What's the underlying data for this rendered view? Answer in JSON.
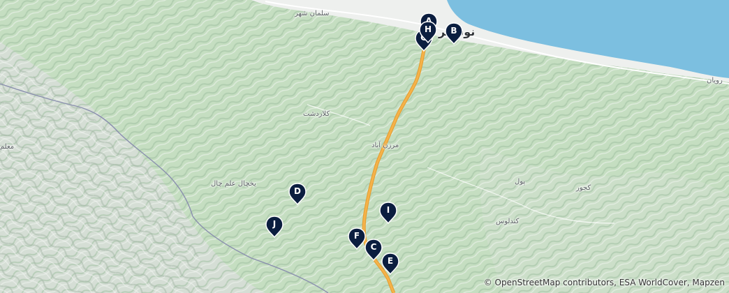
{
  "places": {
    "nowshahr": "نوشهر",
    "salman_shahr": "سلمان شهر",
    "kelardasht": "کلاردشت",
    "marzanabad": "مرزن آباد",
    "yakhchal": "یخچال علم چال",
    "pol": "پول",
    "kojur": "کجور",
    "kandelous": "کندلوس",
    "royan": "رویان",
    "moalem": "معلم"
  },
  "markers": [
    {
      "id": "A",
      "label": "A"
    },
    {
      "id": "B",
      "label": "B"
    },
    {
      "id": "C",
      "label": "C"
    },
    {
      "id": "D",
      "label": "D"
    },
    {
      "id": "E",
      "label": "E"
    },
    {
      "id": "F",
      "label": "F"
    },
    {
      "id": "G",
      "label": "G"
    },
    {
      "id": "H",
      "label": "H"
    },
    {
      "id": "I",
      "label": "I"
    },
    {
      "id": "J",
      "label": "J"
    }
  ],
  "attribution": "© OpenStreetMap contributors, ESA WorldCover, Mapzen",
  "colors": {
    "sea": "#7cbfe0",
    "forest": "#b9d9b4",
    "highway": "#f5b24a",
    "marker": "#0b1e3f",
    "boundary": "#8a8fae"
  }
}
